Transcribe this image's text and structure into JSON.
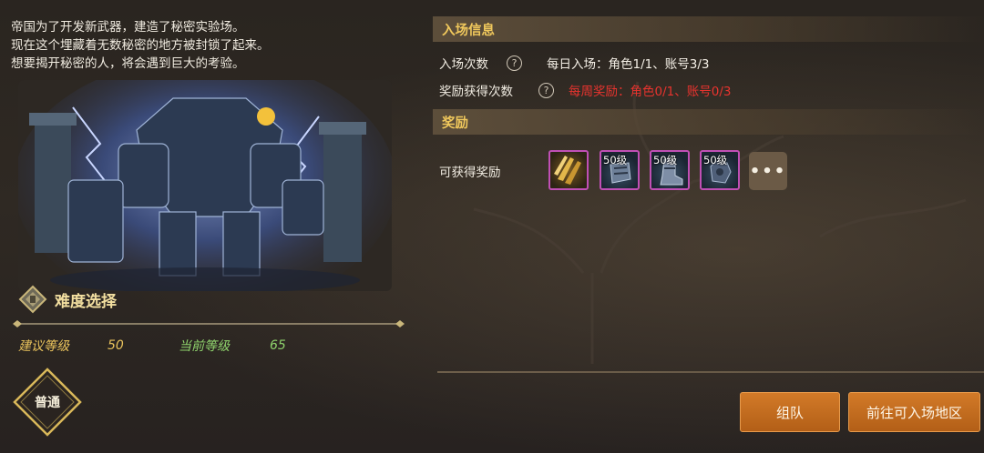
{
  "description": {
    "lines": [
      "帝国为了开发新武器，建造了秘密实验场。",
      "现在这个埋藏着无数秘密的地方被封锁了起来。",
      "想要揭开秘密的人，将会遇到巨大的考验。"
    ]
  },
  "difficulty": {
    "title": "难度选择",
    "recommended_label": "建议等级",
    "recommended_value": "50",
    "current_label": "当前等级",
    "current_value": "65",
    "mode": "普通"
  },
  "entry_info": {
    "header": "入场信息",
    "entry_count_label": "入场次数",
    "entry_count_value": "每日入场：角色1/1、账号3/3",
    "reward_count_label": "奖励获得次数",
    "reward_count_value": "每周奖励：角色0/1、账号0/3",
    "reward_count_color": "#e8332e"
  },
  "rewards": {
    "header": "奖励",
    "label": "可获得奖励",
    "items": [
      {
        "icon": "gold-claw-icon",
        "level": ""
      },
      {
        "icon": "armor-gauntlet-icon",
        "level": "50级"
      },
      {
        "icon": "armor-boot-icon",
        "level": "50级"
      },
      {
        "icon": "armor-glove-icon",
        "level": "50级"
      }
    ],
    "more_label": "•••"
  },
  "actions": {
    "team_button": "组队",
    "goto_button": "前往可入场地区"
  },
  "colors": {
    "accent_gold": "#f0c85c",
    "button_orange": "#c46c1f",
    "item_border": "#c04fb5"
  }
}
